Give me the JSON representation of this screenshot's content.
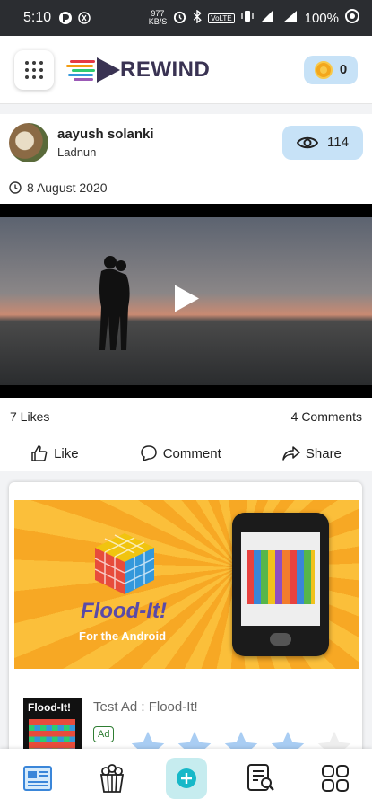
{
  "status_bar": {
    "time": "5:10",
    "net_speed_top": "977",
    "net_speed_unit": "KB/S",
    "volte": "VoLTE",
    "battery": "100%"
  },
  "header": {
    "logo_text": "REWIND",
    "coins": "0"
  },
  "post": {
    "user_name": "aayush  solanki",
    "location": "Ladnun",
    "views": "114",
    "date": "8 August 2020",
    "likes": "7 Likes",
    "comments": "4 Comments",
    "actions": {
      "like": "Like",
      "comment": "Comment",
      "share": "Share"
    }
  },
  "ad": {
    "banner_title": "Flood-It!",
    "banner_subtitle": "For the Android",
    "thumb_title": "Flood-It!",
    "name": "Test Ad : Flood-It!",
    "tag": "Ad",
    "rating": 4,
    "rating_max": 5
  },
  "colors": {
    "accent_blue": "#c7e2f7",
    "logo_text": "#3a3353",
    "add_button": "#c6ecef",
    "star": "#a9cdf3"
  }
}
